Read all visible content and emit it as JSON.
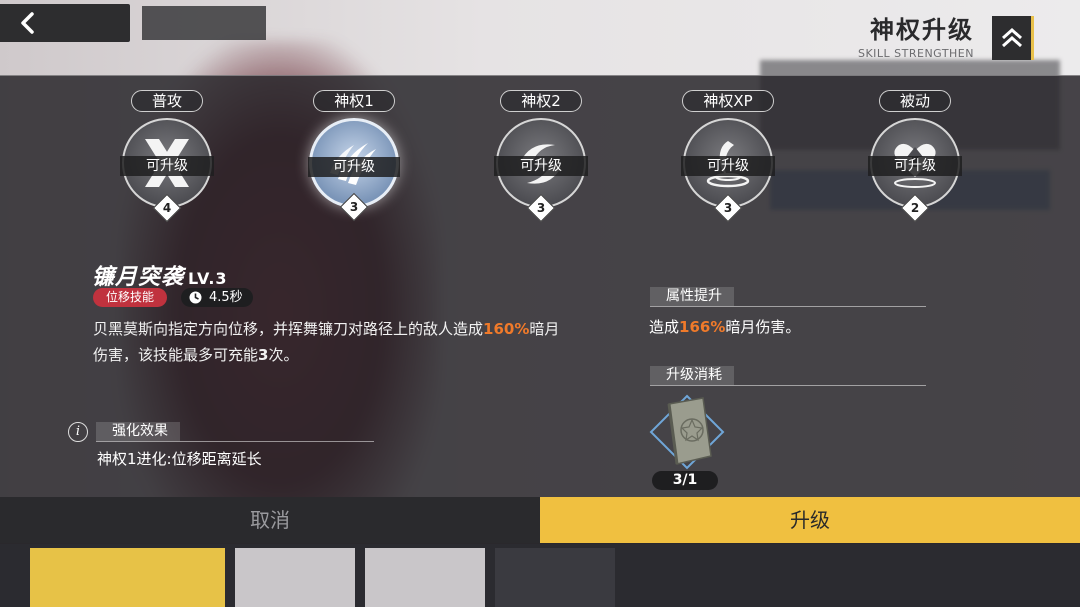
{
  "header": {
    "title": "神权升级",
    "subtitle": "SKILL STRENGTHEN"
  },
  "skills": [
    {
      "tab": "普攻",
      "status": "可升级",
      "level": "4",
      "icon": "cross-slash-icon"
    },
    {
      "tab": "神权1",
      "status": "可升级",
      "level": "3",
      "icon": "claw-slash-icon"
    },
    {
      "tab": "神权2",
      "status": "可升级",
      "level": "3",
      "icon": "crescent-swirl-icon"
    },
    {
      "tab": "神权XP",
      "status": "可升级",
      "level": "3",
      "icon": "scythe-vortex-icon"
    },
    {
      "tab": "被动",
      "status": "可升级",
      "level": "2",
      "icon": "heart-up-icon"
    }
  ],
  "selected_skill": {
    "name": "镰月突袭",
    "level": "LV.3",
    "type_tag": "位移技能",
    "cooldown": "4.5秒",
    "desc": {
      "part1": "贝黑莫斯向指定方向位移，并挥舞镰刀对路径上的敌人造成",
      "value": "160%",
      "part2": "暗月伤害，该技能最多可充能",
      "charges": "3",
      "part3": "次。"
    }
  },
  "enhance": {
    "label": "强化效果",
    "text": "神权1进化:位移距离延长"
  },
  "attribute": {
    "label": "属性提升",
    "prefix": "造成",
    "value": "166%",
    "suffix": "暗月伤害。"
  },
  "cost": {
    "label": "升级消耗",
    "item_icon": "skill-book-icon",
    "count": "3/1"
  },
  "buttons": {
    "cancel": "取消",
    "upgrade": "升级"
  },
  "colors": {
    "accent": "#f0c040",
    "highlight": "#f07a2a",
    "tag_red": "#c0323e"
  }
}
